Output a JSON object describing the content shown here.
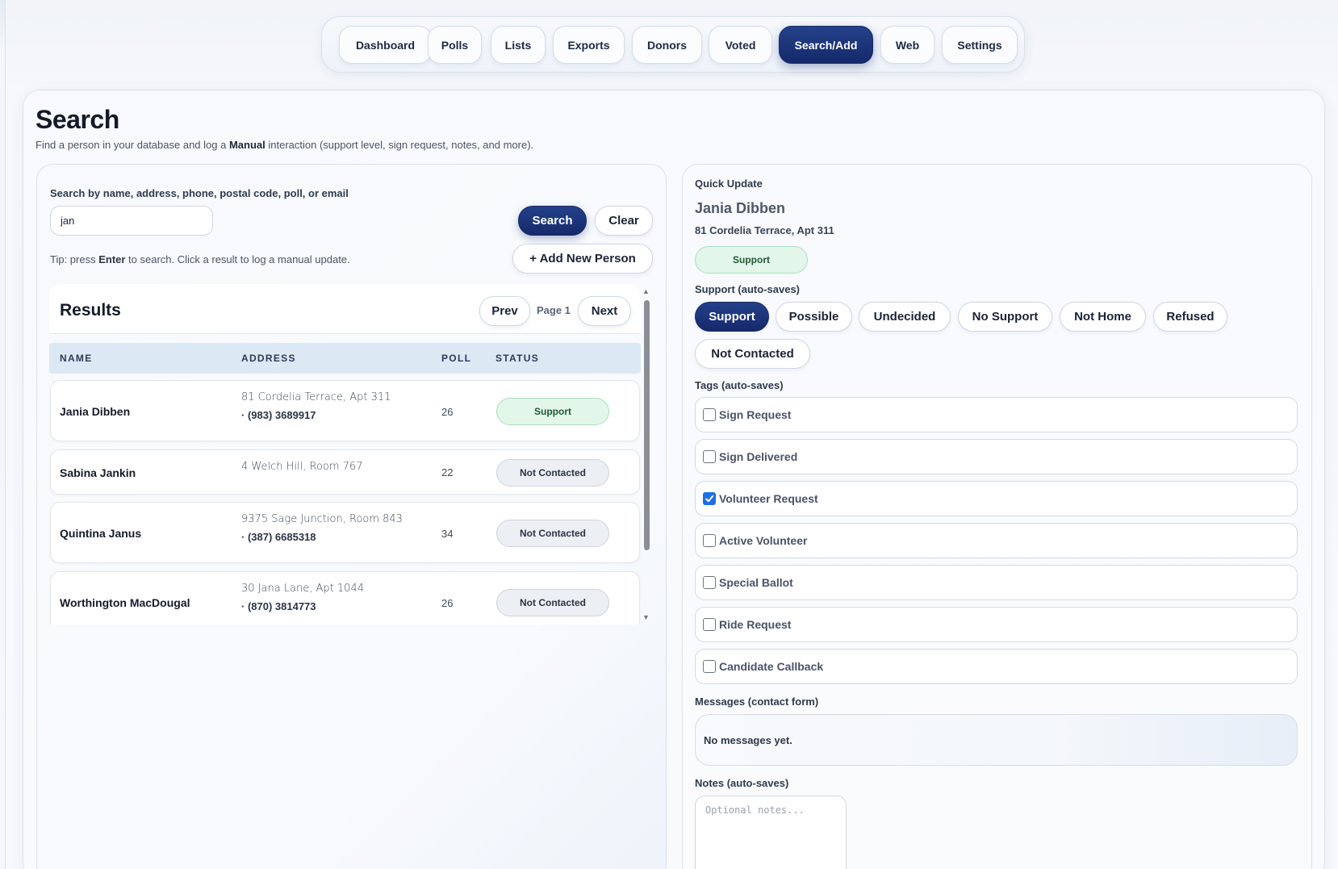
{
  "nav": {
    "tabs": [
      {
        "label": "Dashboard"
      },
      {
        "label": "Polls"
      },
      {
        "label": "Lists"
      },
      {
        "label": "Exports"
      },
      {
        "label": "Donors"
      },
      {
        "label": "Voted"
      },
      {
        "label": "Search/Add",
        "active": true
      },
      {
        "label": "Web"
      },
      {
        "label": "Settings"
      }
    ]
  },
  "page": {
    "title": "Search",
    "subtitle_pre": "Find a person in your database and log a ",
    "subtitle_bold": "Manual",
    "subtitle_post": " interaction (support level, sign request, notes, and more)."
  },
  "search": {
    "label": "Search by name, address, phone, postal code, poll, or email",
    "value": "jan",
    "search_button": "Search",
    "clear_button": "Clear",
    "add_button": "+ Add New Person",
    "tip_pre": "Tip: press ",
    "tip_bold": "Enter",
    "tip_post": " to search. Click a result to log a manual update."
  },
  "results": {
    "title": "Results",
    "prev_button": "Prev",
    "page_label": "Page 1",
    "next_button": "Next",
    "columns": [
      "NAME",
      "ADDRESS",
      "POLL",
      "STATUS"
    ],
    "rows": [
      {
        "name": "Jania Dibben",
        "address": "81 Cordelia Terrace, Apt 311",
        "phone": "· (983) 3689917",
        "poll": "26",
        "status": "Support"
      },
      {
        "name": "Sabina Jankin",
        "address": "4 Welch Hill, Room 767",
        "phone": "",
        "poll": "22",
        "status": "Not Contacted"
      },
      {
        "name": "Quintina Janus",
        "address": "9375 Sage Junction, Room 843",
        "phone": "· (387) 6685318",
        "poll": "34",
        "status": "Not Contacted"
      },
      {
        "name": "Worthington MacDougal",
        "address": "30 Jana Lane, Apt 1044",
        "phone": "· (870) 3814773",
        "poll": "26",
        "status": "Not Contacted"
      }
    ]
  },
  "quick_update": {
    "heading": "Quick Update",
    "name": "Jania Dibben",
    "address": "81 Cordelia Terrace, Apt 311",
    "current_status": "Support",
    "support_label": "Support (auto-saves)",
    "support_options": [
      "Support",
      "Possible",
      "Undecided",
      "No Support",
      "Not Home",
      "Refused",
      "Not Contacted"
    ],
    "selected_support": "Support",
    "tags_label": "Tags (auto-saves)",
    "tags": [
      {
        "label": "Sign Request",
        "checked": false
      },
      {
        "label": "Sign Delivered",
        "checked": false
      },
      {
        "label": "Volunteer Request",
        "checked": true
      },
      {
        "label": "Active Volunteer",
        "checked": false
      },
      {
        "label": "Special Ballot",
        "checked": false
      },
      {
        "label": "Ride Request",
        "checked": false
      },
      {
        "label": "Candidate Callback",
        "checked": false
      }
    ],
    "messages_label": "Messages (contact form)",
    "messages_empty": "No messages yet.",
    "notes_label": "Notes (auto-saves)",
    "notes_placeholder": "Optional notes..."
  },
  "colors": {
    "accent": "#1c3478",
    "support_bg": "#e3f6ea",
    "support_text": "#1c5b34",
    "neutral_pill": "#eceff3",
    "checkbox_checked": "#1d6fe3"
  }
}
